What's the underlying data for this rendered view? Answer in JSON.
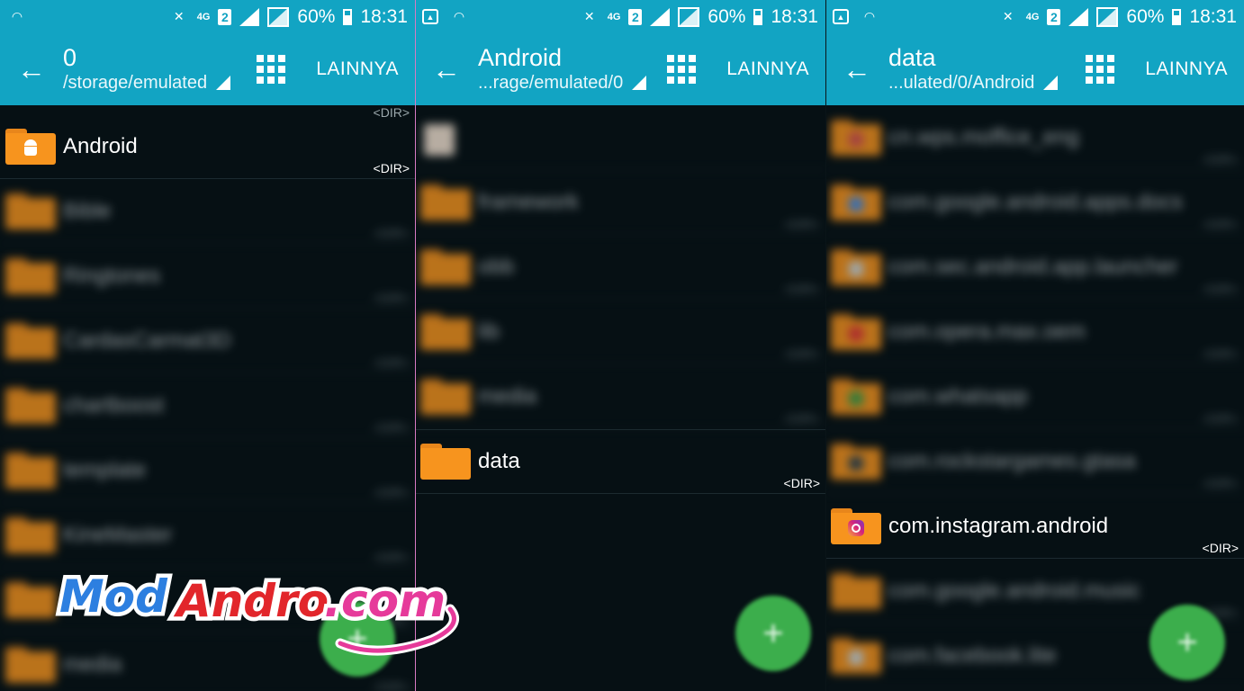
{
  "status_bar": {
    "battery": "60%",
    "time": "18:31",
    "network": "4G",
    "sim": "2"
  },
  "panels": [
    {
      "title": "0",
      "subtitle": "/storage/emulated",
      "more_label": "LAINNYA",
      "dir_label": "<DIR>",
      "focused_item": {
        "name": "Android"
      },
      "items_blurred": [
        "Bible",
        "Ringtones",
        "CardasCarmat3D",
        "chartboost",
        "template",
        "KineMaster",
        "",
        "media"
      ]
    },
    {
      "title": "Android",
      "subtitle": "...rage/emulated/0",
      "more_label": "LAINNYA",
      "dir_label": "<DIR>",
      "items_blurred": [
        "",
        "framework",
        "obb",
        "lib",
        "media"
      ],
      "focused_item": {
        "name": "data"
      }
    },
    {
      "title": "data",
      "subtitle": "...ulated/0/Android",
      "more_label": "LAINNYA",
      "dir_label": "<DIR>",
      "items_blurred": [
        "cn.wps.moffice_eng",
        "com.google.android.apps.docs",
        "com.sec.android.app.launcher",
        "com.opera.max.oem",
        "com.whatsapp",
        "com.rockstargames.gtasa"
      ],
      "focused_item": {
        "name": "com.instagram.android"
      },
      "items_blurred_after": [
        "com.google.android.music",
        "com.facebook.lite"
      ]
    }
  ],
  "fab_label": "+",
  "watermark": {
    "part1": "Mod",
    "part2": "Andro",
    "part3": ".com"
  },
  "colors": {
    "accent": "#12a4c3",
    "folder": "#f7941e",
    "fab": "#3cae4c",
    "background": "#061014"
  }
}
